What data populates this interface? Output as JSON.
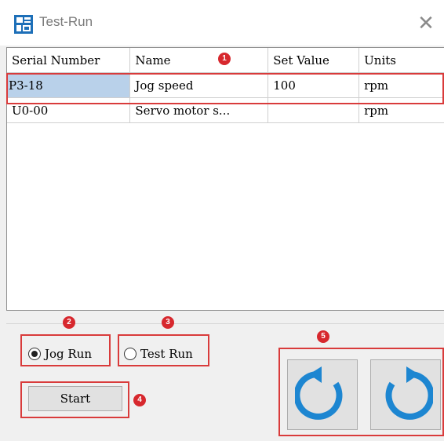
{
  "window": {
    "title": "Test-Run",
    "close_glyph": "✕"
  },
  "table": {
    "columns": [
      "Serial Number",
      "Name",
      "Set Value",
      "Units"
    ],
    "rows": [
      [
        "P3-18",
        "Jog speed",
        "100",
        "rpm"
      ],
      [
        "U0-00",
        "Servo motor s...",
        "",
        "rpm"
      ]
    ]
  },
  "mode": {
    "jog_label": "Jog Run",
    "test_label": "Test Run",
    "selected": "Jog Run"
  },
  "start_label": "Start",
  "rotate_buttons": [
    {
      "icon": "rotate-counterclockwise-icon"
    },
    {
      "icon": "rotate-clockwise-icon"
    }
  ],
  "annotations": [
    "1",
    "2",
    "3",
    "4",
    "5"
  ],
  "colors": {
    "highlight": "#d93b3b",
    "badge": "#d7282e",
    "selection": "#b9d1ea",
    "arrow": "#1d86d1"
  }
}
